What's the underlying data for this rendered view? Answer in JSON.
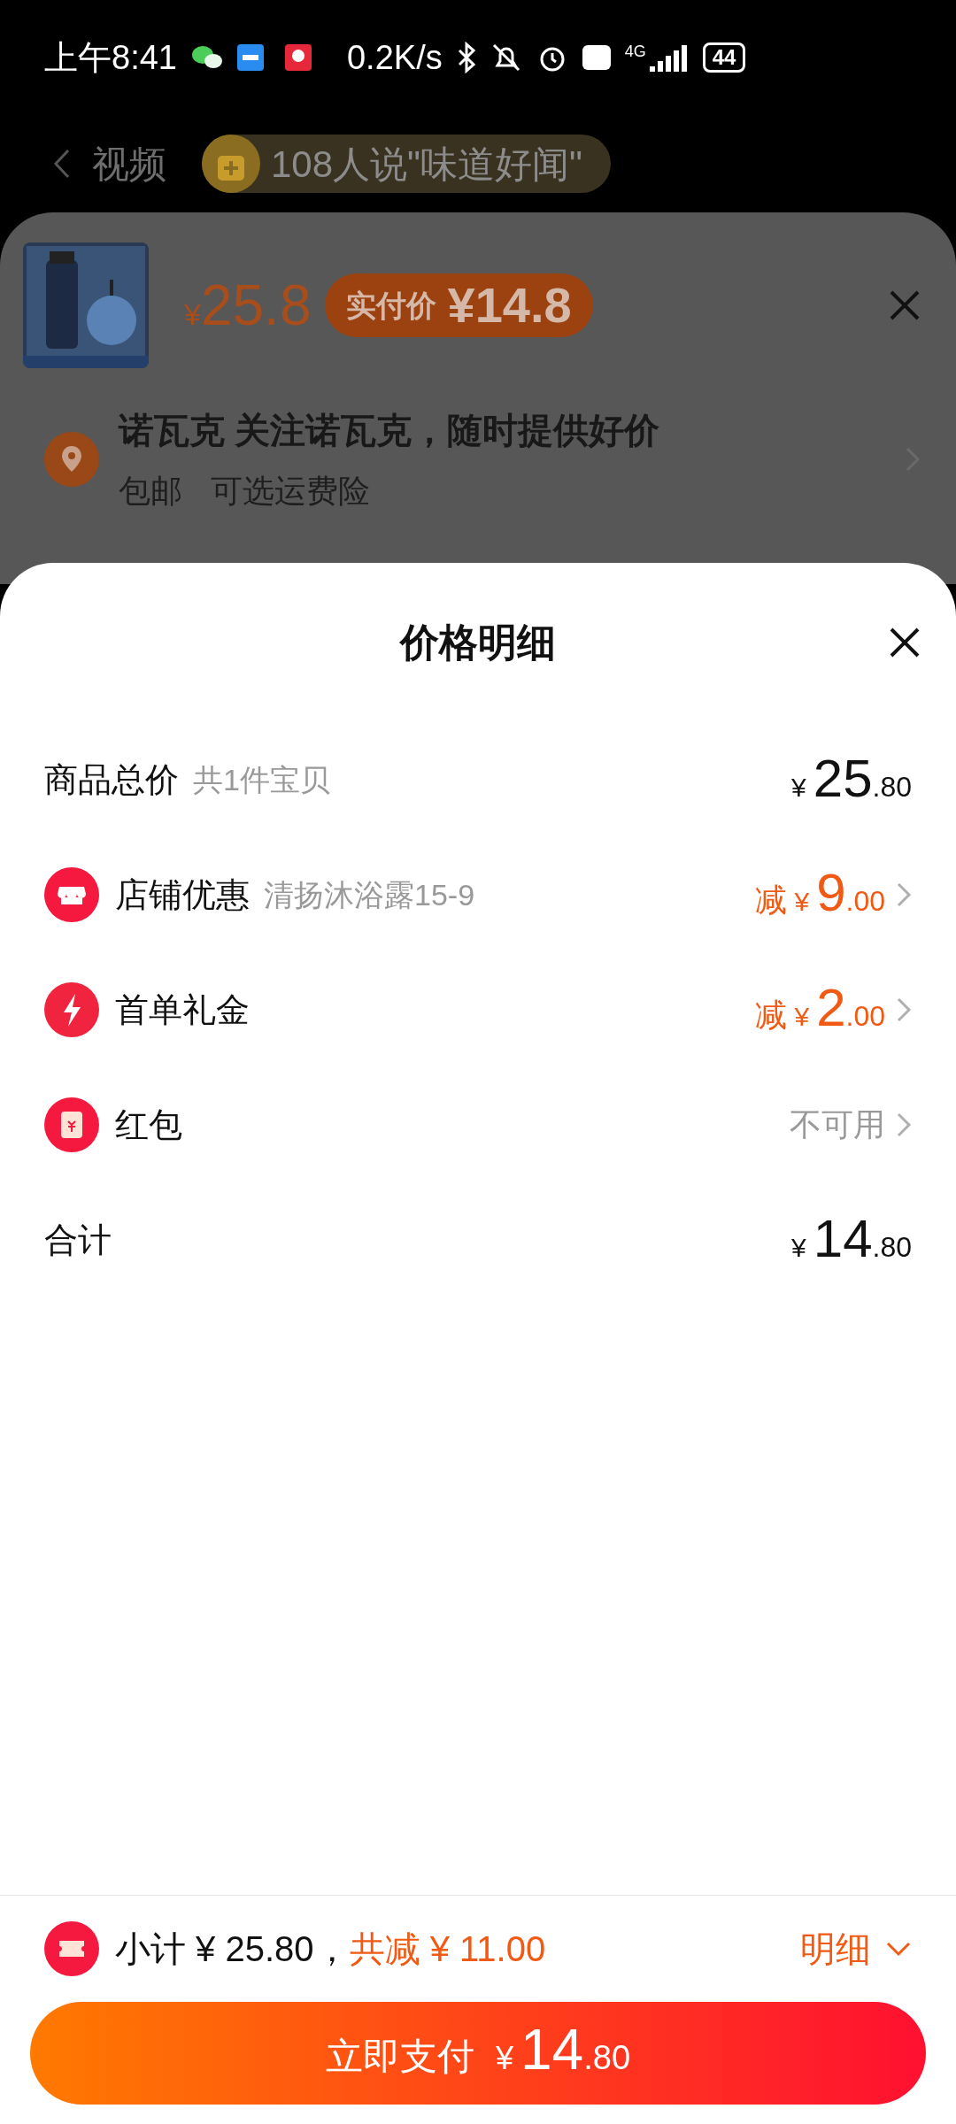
{
  "status_bar": {
    "time": "上午8:41",
    "speed": "0.2K/s",
    "network": "4G",
    "battery": "44"
  },
  "header": {
    "tab": "视频",
    "banner": "108人说\"味道好闻\""
  },
  "product_sheet": {
    "currency": "¥",
    "price": "25.8",
    "actual_label": "实付价",
    "actual_price": "¥14.8",
    "shop": "诺瓦克 关注诺瓦克，随时提供好价",
    "tags": [
      "包邮",
      "可选运费险"
    ]
  },
  "detail": {
    "title": "价格明细",
    "rows": [
      {
        "kind": "plain",
        "label": "商品总价",
        "note": "共1件宝贝",
        "currency": "¥",
        "integer": "25",
        "decimal": ".80"
      },
      {
        "kind": "shop",
        "label": "店铺优惠",
        "note": "清扬沐浴露15-9",
        "prefix": "减",
        "currency": "¥",
        "integer": "9",
        "decimal": ".00"
      },
      {
        "kind": "gift",
        "label": "首单礼金",
        "prefix": "减",
        "currency": "¥",
        "integer": "2",
        "decimal": ".00"
      },
      {
        "kind": "packet",
        "label": "红包",
        "status": "不可用"
      },
      {
        "kind": "plain",
        "label": "合计",
        "currency": "¥",
        "integer": "14",
        "decimal": ".80"
      }
    ]
  },
  "footer": {
    "subtotal": "小计 ¥ 25.80，",
    "saved": "共减 ¥ 11.00",
    "toggle": "明细",
    "pay": {
      "label": "立即支付",
      "currency": "¥",
      "integer": "14",
      "decimal": ".80"
    }
  }
}
